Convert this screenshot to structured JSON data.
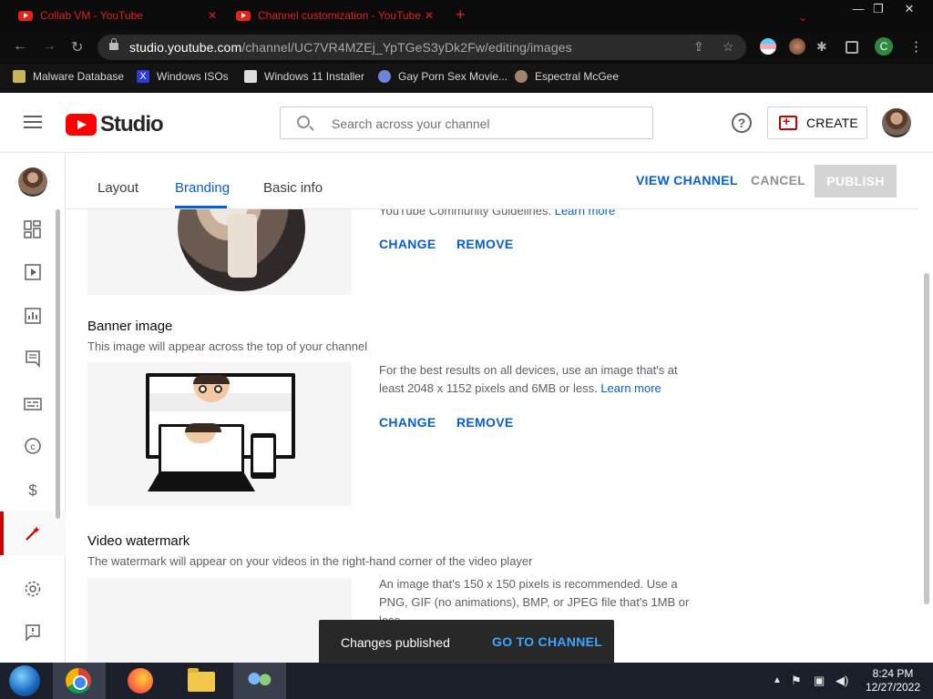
{
  "browser": {
    "tabs": [
      {
        "title": "Collab VM - YouTube",
        "icon": "youtube-icon"
      },
      {
        "title": "Channel customization - YouTube",
        "icon": "youtube-icon"
      }
    ],
    "new_tab_label": "+",
    "url_domain": "studio.youtube.com",
    "url_path": "/channel/UC7VR4MZEj_YpTGeS3yDk2Fw/editing/images",
    "profile_initial": "C",
    "bookmarks": [
      {
        "label": "Malware Database",
        "icon": "malware-icon"
      },
      {
        "label": "Windows ISOs",
        "icon": "x-icon"
      },
      {
        "label": "Windows 11 Installer",
        "icon": "installer-icon"
      },
      {
        "label": "Gay Porn Sex Movie...",
        "icon": "site-icon"
      },
      {
        "label": "Espectral McGee",
        "icon": "site-icon"
      }
    ]
  },
  "header": {
    "logo_text": "Studio",
    "search_placeholder": "Search across your channel",
    "create_label": "CREATE",
    "help_label": "?"
  },
  "subnav": {
    "tabs": [
      {
        "label": "Layout",
        "active": false
      },
      {
        "label": "Branding",
        "active": true
      },
      {
        "label": "Basic info",
        "active": false
      }
    ],
    "view_channel": "VIEW CHANNEL",
    "cancel": "CANCEL",
    "publish": "PUBLISH"
  },
  "sidebar": {
    "items": [
      {
        "name": "dashboard",
        "icon": "dashboard-icon"
      },
      {
        "name": "content",
        "icon": "content-icon"
      },
      {
        "name": "analytics",
        "icon": "analytics-icon"
      },
      {
        "name": "comments",
        "icon": "comments-icon"
      },
      {
        "name": "subtitles",
        "icon": "subtitles-icon"
      },
      {
        "name": "copyright",
        "icon": "copyright-icon"
      },
      {
        "name": "earn",
        "icon": "earn-icon"
      },
      {
        "name": "customization",
        "icon": "customization-icon",
        "active": true
      },
      {
        "name": "settings",
        "icon": "settings-icon"
      },
      {
        "name": "feedback",
        "icon": "feedback-icon"
      }
    ]
  },
  "picture": {
    "guidelines_text": "YouTube Community Guidelines.",
    "learn_more": "Learn more",
    "change": "CHANGE",
    "remove": "REMOVE"
  },
  "banner": {
    "title": "Banner image",
    "description": "This image will appear across the top of your channel",
    "help_text": "For the best results on all devices, use an image that's at least 2048 x 1152 pixels and 6MB or less.",
    "learn_more": "Learn more",
    "change": "CHANGE",
    "remove": "REMOVE"
  },
  "watermark": {
    "title": "Video watermark",
    "description": "The watermark will appear on your videos in the right-hand corner of the video player",
    "help_text": "An image that's 150 x 150 pixels is recommended. Use a PNG, GIF (no animations), BMP, or JPEG file that's 1MB or less."
  },
  "toast": {
    "message": "Changes published",
    "action": "GO TO CHANNEL"
  },
  "taskbar": {
    "time": "8:24 PM",
    "date": "12/27/2022"
  },
  "colors": {
    "accent_blue": "#065fd4",
    "brand_red": "#ff0000",
    "tab_red": "#e0201b"
  }
}
